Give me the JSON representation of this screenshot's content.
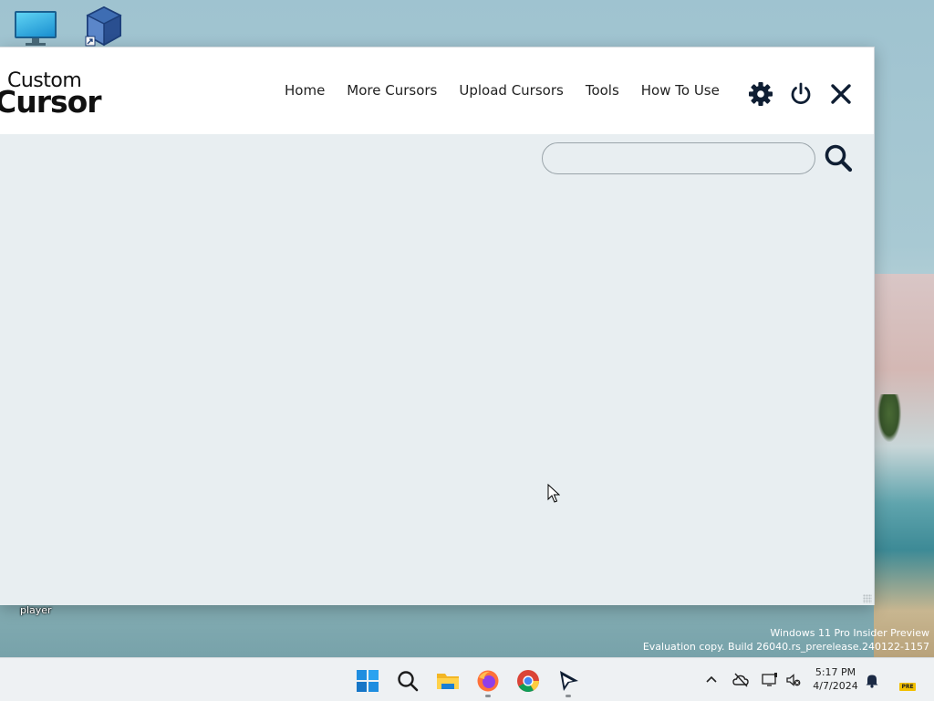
{
  "app": {
    "logo_line1": "Custom",
    "logo_line2": "Cursor",
    "nav": [
      "Home",
      "More Cursors",
      "Upload Cursors",
      "Tools",
      "How To Use"
    ],
    "search": {
      "value": "",
      "placeholder": ""
    },
    "header_icons": [
      "gear-icon",
      "power-icon",
      "close-icon"
    ]
  },
  "desktop": {
    "icons": [
      "this-pc-icon",
      "virtualbox-icon"
    ],
    "label": "player",
    "watermark_line1": "Windows 11 Pro Insider Preview",
    "watermark_line2": "Evaluation copy. Build 26040.rs_prerelease.240122-1157"
  },
  "taskbar": {
    "apps": [
      "start-icon",
      "search-icon",
      "file-explorer-icon",
      "firefox-icon",
      "chrome-icon",
      "custom-cursor-icon"
    ],
    "tray": [
      "chevron-up-icon",
      "onedrive-icon",
      "network-icon",
      "volume-icon",
      "bell-icon"
    ],
    "time": "5:17 PM",
    "date": "4/7/2024",
    "badge": "PRE"
  },
  "colors": {
    "window_bg": "#e8eef1",
    "header_bg": "#ffffff",
    "icon_dark": "#0f1e33"
  }
}
